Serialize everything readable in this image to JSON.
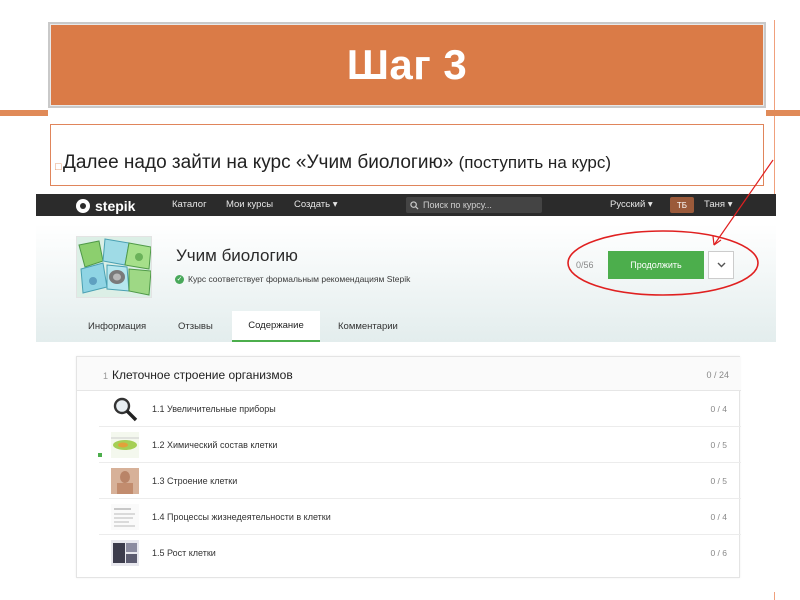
{
  "slide": {
    "title": "Шаг 3",
    "body_main": "Далее надо зайти на курс «Учим биологию» ",
    "body_paren": "(поступить на курс)"
  },
  "nav": {
    "logo": "stepik",
    "items": [
      "Каталог",
      "Мои курсы",
      "Создать ▾"
    ],
    "search_placeholder": "Поиск по курсу...",
    "language": "Русский ▾",
    "avatar_initials": "ТБ",
    "user_name": "Таня ▾"
  },
  "course": {
    "title": "Учим биологию",
    "note": "Курс соответствует формальным рекомендациям Stepik",
    "progress": "0/56",
    "continue_label": "Продолжить"
  },
  "tabs": [
    {
      "label": "Информация"
    },
    {
      "label": "Отзывы"
    },
    {
      "label": "Содержание",
      "active": true
    },
    {
      "label": "Комментарии"
    }
  ],
  "module": {
    "number": "1",
    "title": "Клеточное строение организмов",
    "count": "0 / 24",
    "lessons": [
      {
        "title": "1.1 Увеличительные приборы",
        "count": "0 / 4",
        "icon": "magnifier-icon"
      },
      {
        "title": "1.2 Химический состав клетки",
        "count": "0 / 5",
        "icon": "cell-image-icon"
      },
      {
        "title": "1.3 Строение клетки",
        "count": "0 / 5",
        "icon": "photo-icon"
      },
      {
        "title": "1.4 Процессы жизнедеятельности в клетки",
        "count": "0 / 4",
        "icon": "document-icon"
      },
      {
        "title": "1.5 Рост клетки",
        "count": "0 / 6",
        "icon": "microscope-image-icon"
      }
    ]
  },
  "colors": {
    "title_bar": "#da7b47",
    "accent_line": "#e08a58",
    "stepik_green": "#4cae4c",
    "annotation_red": "#e02020"
  }
}
